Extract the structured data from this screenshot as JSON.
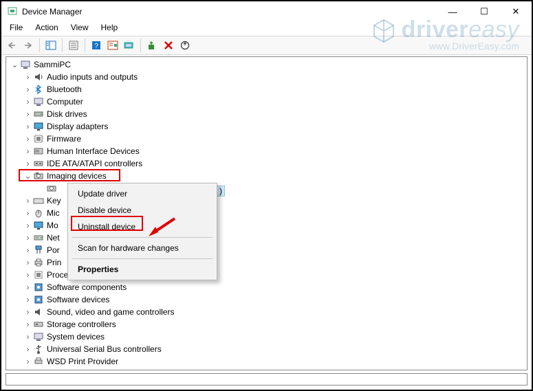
{
  "window": {
    "title": "Device Manager",
    "buttons": {
      "min": "—",
      "max": "☐",
      "close": "✕"
    }
  },
  "menubar": [
    "File",
    "Action",
    "View",
    "Help"
  ],
  "watermark": {
    "line1_a": "driver",
    "line1_b": "easy",
    "line2": "www.DriverEasy.com"
  },
  "tree": {
    "root": "SammiPC",
    "nodes": [
      "Audio inputs and outputs",
      "Bluetooth",
      "Computer",
      "Disk drives",
      "Display adapters",
      "Firmware",
      "Human Interface Devices",
      "IDE ATA/ATAPI controllers",
      "Imaging devices",
      "Key",
      "Mic",
      "Mo",
      "Net",
      "Por",
      "Prin",
      "Processors",
      "Software components",
      "Software devices",
      "Sound, video and game controllers",
      "Storage controllers",
      "System devices",
      "Universal Serial Bus controllers",
      "WSD Print Provider"
    ],
    "child_truncated": ")"
  },
  "context_menu": {
    "items": [
      "Update driver",
      "Disable device",
      "Uninstall device",
      "Scan for hardware changes",
      "Properties"
    ]
  }
}
